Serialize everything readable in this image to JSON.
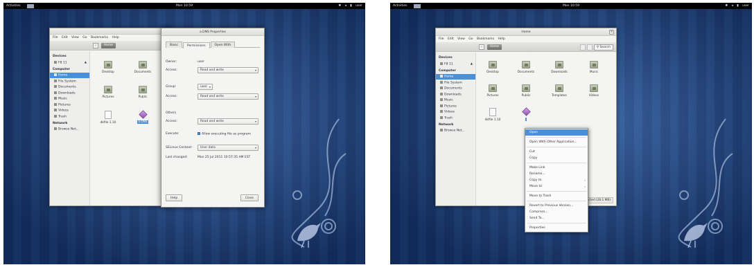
{
  "topbar": {
    "activities": "Activities",
    "clock": "Mon 10:59",
    "user": "user"
  },
  "left": {
    "nautilus": {
      "menu": [
        "File",
        "Edit",
        "View",
        "Go",
        "Bookmarks",
        "Help"
      ],
      "path": "Home",
      "sidebar": {
        "devices_head": "Devices",
        "devices": [
          "F8 11"
        ],
        "computer_head": "Computer",
        "computer": [
          "Home",
          "File System",
          "Documents",
          "Downloads",
          "Music",
          "Pictures",
          "Videos",
          "Trash"
        ],
        "network_head": "Network",
        "network": [
          "Browse Net..."
        ]
      },
      "files": [
        {
          "label": "Desktop",
          "kind": "folder"
        },
        {
          "label": "Documents",
          "kind": "folder"
        },
        {
          "label": "Pictures",
          "kind": "folder"
        },
        {
          "label": "Public",
          "kind": "folder"
        },
        {
          "label": "dkfile 1.10",
          "kind": "doc"
        },
        {
          "label": "a.DNS",
          "kind": "image"
        }
      ]
    },
    "dialog": {
      "title": "a.DNS Properties",
      "tabs": [
        "Basic",
        "Permissions",
        "Open With"
      ],
      "owner_label": "Owner:",
      "owner_value": "user",
      "owner_access_label": "Access:",
      "owner_access": "Read and write",
      "group_label": "Group:",
      "group_value": "user",
      "group_access_label": "Access:",
      "group_access": "Read and write",
      "others_head": "Others",
      "others_access_label": "Access:",
      "others_access": "Read and write",
      "execute_label": "Execute:",
      "execute_value": "Allow executing file as program",
      "selinux_label": "SELinux Context:",
      "selinux_value": "User data",
      "changed_label": "Last changed:",
      "changed_value": "Mon 25 Jul 2011 10:57:35 AM EST",
      "help": "Help",
      "close": "Close"
    }
  },
  "right": {
    "nautilus": {
      "title": "Home",
      "menu": [
        "File",
        "Edit",
        "View",
        "Go",
        "Bookmarks",
        "Help"
      ],
      "path": "Home",
      "search": "Search",
      "sidebar": {
        "devices_head": "Devices",
        "devices": [
          "F8 11"
        ],
        "computer_head": "Computer",
        "computer": [
          "Home",
          "File System",
          "Documents",
          "Downloads",
          "Music",
          "Pictures",
          "Videos",
          "Trash"
        ],
        "network_head": "Network",
        "network": [
          "Browse Net..."
        ]
      },
      "files": [
        {
          "label": "Desktop",
          "kind": "folder"
        },
        {
          "label": "Documents",
          "kind": "folder"
        },
        {
          "label": "Downloads",
          "kind": "folder"
        },
        {
          "label": "Music",
          "kind": "folder"
        },
        {
          "label": "Pictures",
          "kind": "folder"
        },
        {
          "label": "Public",
          "kind": "folder"
        },
        {
          "label": "Templates",
          "kind": "folder"
        },
        {
          "label": "Videos",
          "kind": "folder"
        },
        {
          "label": "dkfile 1.10",
          "kind": "doc"
        },
        {
          "label": "",
          "kind": "image"
        }
      ],
      "status": "cted (26.1 MB)"
    },
    "context_menu": {
      "items": [
        {
          "label": "Open",
          "highlight": true
        },
        {
          "sep": true
        },
        {
          "label": "Open With Other Application..."
        },
        {
          "sep": true
        },
        {
          "label": "Cut"
        },
        {
          "label": "Copy"
        },
        {
          "sep": true
        },
        {
          "label": "Make Link"
        },
        {
          "label": "Rename..."
        },
        {
          "label": "Copy to",
          "submenu": true
        },
        {
          "label": "Move to",
          "submenu": true
        },
        {
          "sep": true
        },
        {
          "label": "Move to Trash"
        },
        {
          "sep": true
        },
        {
          "label": "Revert to Previous Version..."
        },
        {
          "label": "Compress..."
        },
        {
          "label": "Send To..."
        },
        {
          "sep": true
        },
        {
          "label": "Properties"
        }
      ]
    }
  },
  "colors": {
    "wallpaper": "#1b3f7a",
    "selection": "#4a90d9",
    "topbar": "#000000"
  }
}
